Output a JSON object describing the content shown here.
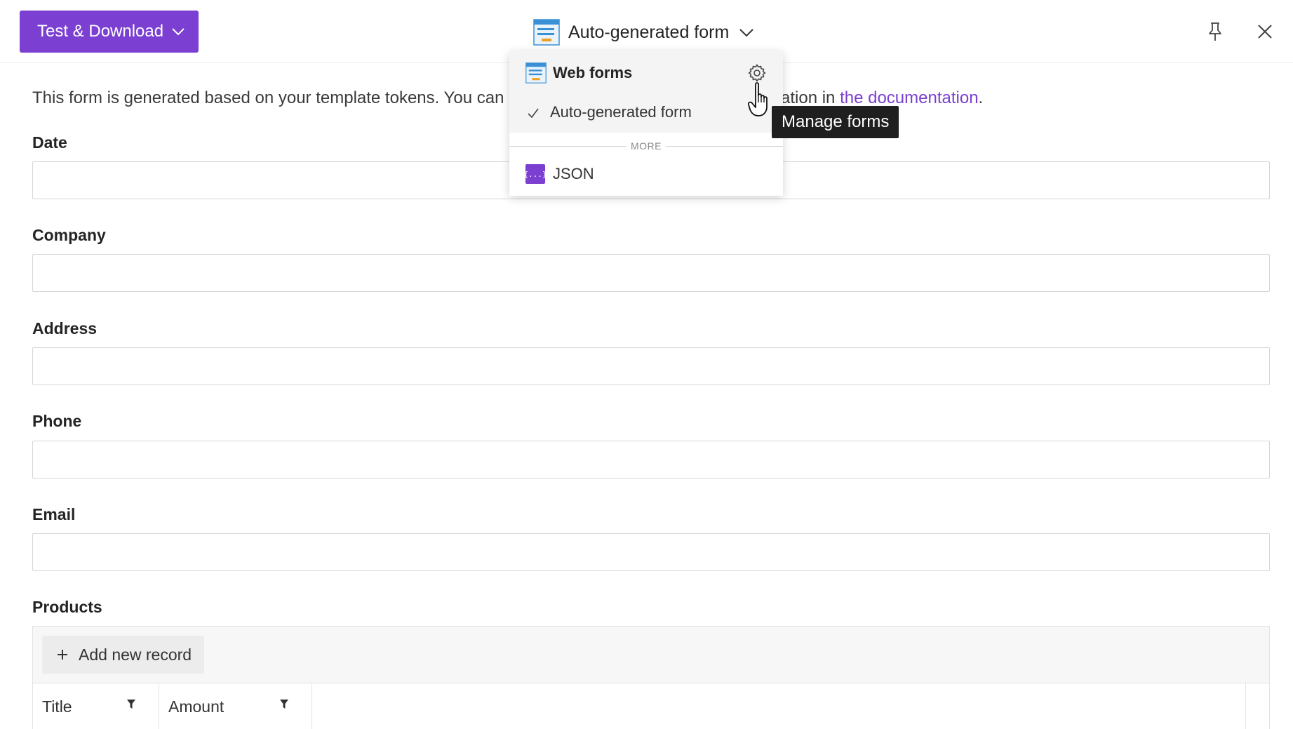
{
  "header": {
    "primary_button_label": "Test & Download",
    "form_selector_title": "Auto-generated form"
  },
  "intro": {
    "text_start": "This form is generated based on your template tokens. You can a",
    "text_end_prefix": "ation in ",
    "link_text": "the documentation",
    "text_end_suffix": "."
  },
  "fields": [
    {
      "label": "Date",
      "value": ""
    },
    {
      "label": "Company",
      "value": ""
    },
    {
      "label": "Address",
      "value": ""
    },
    {
      "label": "Phone",
      "value": ""
    },
    {
      "label": "Email",
      "value": ""
    }
  ],
  "products": {
    "label": "Products",
    "add_button_label": "Add new record",
    "columns": [
      {
        "label": "Title"
      },
      {
        "label": "Amount"
      }
    ]
  },
  "dropdown": {
    "group_title": "Web forms",
    "selected_item": "Auto-generated form",
    "more_label": "MORE",
    "json_item": "JSON",
    "json_icon_text": "{...}"
  },
  "tooltip": {
    "text": "Manage forms"
  },
  "colors": {
    "accent": "#7b3fd1",
    "tooltip_bg": "#1f1f1f"
  },
  "icons": {
    "form": "form-icon",
    "gear": "gear-icon",
    "pin": "pin-icon",
    "close": "close-icon",
    "check": "check-icon",
    "filter": "filter-icon",
    "plus": "plus-icon"
  }
}
